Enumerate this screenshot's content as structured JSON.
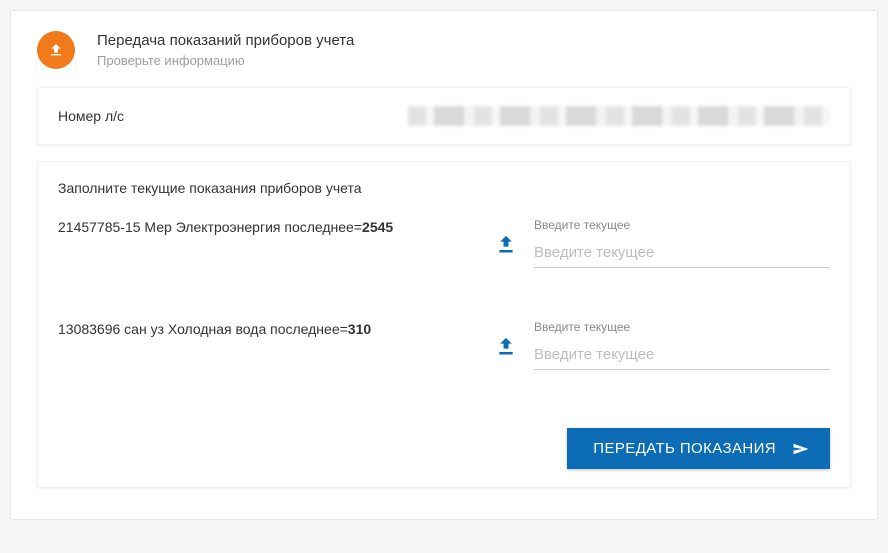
{
  "header": {
    "title": "Передача показаний приборов учета",
    "subtitle": "Проверьте информацию"
  },
  "account": {
    "label": "Номер л/с"
  },
  "form": {
    "title": "Заполните текущие показания приборов учета",
    "meters": [
      {
        "prefix": "21457785-15 Мер Электроэнергия последнее=",
        "last_value": "2545",
        "input_label": "Введите текущее",
        "placeholder": "Введите текущее"
      },
      {
        "prefix": "13083696 сан уз Холодная вода последнее=",
        "last_value": "310",
        "input_label": "Введите текущее",
        "placeholder": "Введите текущее"
      }
    ],
    "submit_label": "ПЕРЕДАТЬ ПОКАЗАНИЯ"
  }
}
